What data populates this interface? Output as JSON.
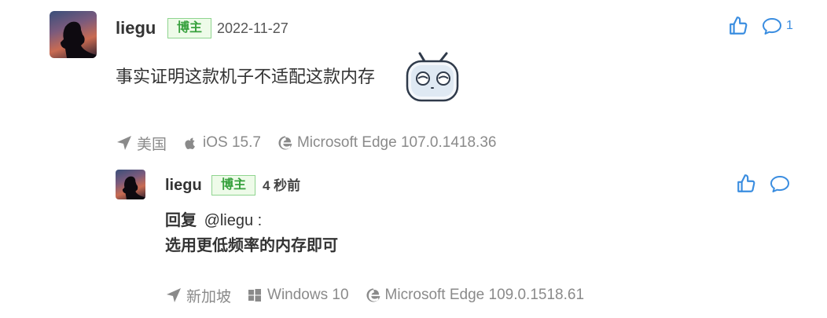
{
  "comment": {
    "username": "liegu",
    "badge": "博主",
    "date": "2022-11-27",
    "text": "事实证明这款机子不适配这款内存",
    "reply_count": "1",
    "meta": {
      "location": "美国",
      "os": "iOS 15.7",
      "browser": "Microsoft Edge 107.0.1418.36"
    }
  },
  "reply": {
    "username": "liegu",
    "badge": "博主",
    "time": "4 秒前",
    "reply_prefix": "回复",
    "reply_to": "@liegu :",
    "text": "选用更低频率的内存即可",
    "meta": {
      "location": "新加坡",
      "os": "Windows 10",
      "browser": "Microsoft Edge 109.0.1518.61"
    }
  },
  "icons": {
    "like": "thumbs-up-icon",
    "comment": "comment-bubble-icon",
    "location": "location-arrow-icon",
    "apple": "apple-icon",
    "windows": "windows-icon",
    "edge": "edge-icon",
    "sticker": "bilibili-tv-sticker"
  },
  "colors": {
    "accent": "#3a8de0",
    "badge_text": "#37a13d",
    "badge_border": "#8fd48f",
    "meta_text": "#8a8a8a"
  }
}
